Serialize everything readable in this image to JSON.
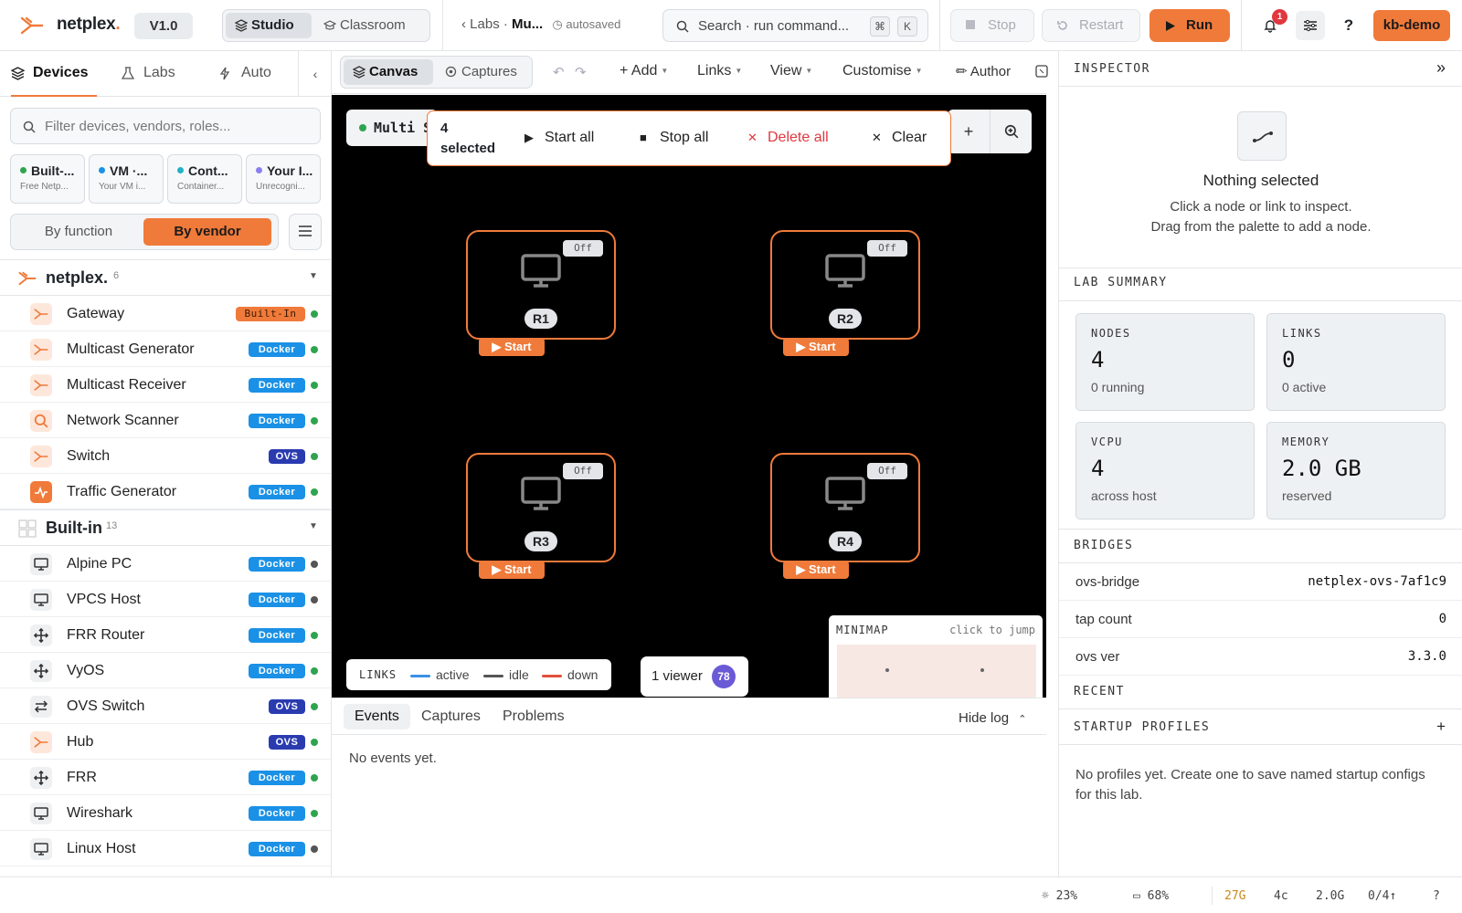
{
  "app": {
    "brand": "netplex",
    "brand_dot": ".",
    "version": "V1.0"
  },
  "modes": [
    "Studio",
    "Classroom"
  ],
  "breadcrumb": {
    "back": "Labs",
    "sep": "·",
    "current": "Mu...",
    "status": "autosaved"
  },
  "search": {
    "placeholder": "Search · run command...",
    "key1": "⌘",
    "key2": "K"
  },
  "toolbar": {
    "stop": "Stop",
    "restart": "Restart",
    "run": "Run",
    "notifications": "1",
    "help": "?",
    "user": "kb-demo"
  },
  "left_tabs": [
    "Devices",
    "Labs",
    "Auto"
  ],
  "filter_placeholder": "Filter devices, vendors, roles...",
  "palette_cards": [
    {
      "title": "Built-...",
      "sub": "Free Netp...",
      "color": "#2fa44f"
    },
    {
      "title": "VM ·...",
      "sub": "Your VM i...",
      "color": "#1a91e6"
    },
    {
      "title": "Cont...",
      "sub": "Container...",
      "color": "#20b2c8"
    },
    {
      "title": "Your I...",
      "sub": "Unrecogni...",
      "color": "#8a7ff0"
    }
  ],
  "grouping": {
    "by_function": "By function",
    "by_vendor": "By vendor"
  },
  "groups": [
    {
      "name": "netplex.",
      "count": "6",
      "items": [
        {
          "name": "Gateway",
          "tag": "Built-In",
          "kind": "bi",
          "status": "green",
          "icon": "netplex-logo-icon"
        },
        {
          "name": "Multicast Generator",
          "tag": "Docker",
          "kind": "docker",
          "status": "green",
          "icon": "netplex-logo-icon"
        },
        {
          "name": "Multicast Receiver",
          "tag": "Docker",
          "kind": "docker",
          "status": "green",
          "icon": "netplex-logo-icon"
        },
        {
          "name": "Network Scanner",
          "tag": "Docker",
          "kind": "docker",
          "status": "green",
          "icon": "magnifier-icon"
        },
        {
          "name": "Switch",
          "tag": "OVS",
          "kind": "ovs",
          "status": "green",
          "icon": "netplex-logo-icon"
        },
        {
          "name": "Traffic Generator",
          "tag": "Docker",
          "kind": "docker",
          "status": "green",
          "icon": "pulse-icon"
        }
      ]
    },
    {
      "name": "Built-in",
      "count": "13",
      "items": [
        {
          "name": "Alpine PC",
          "tag": "Docker",
          "kind": "docker",
          "status": "gray",
          "icon": "monitor-icon"
        },
        {
          "name": "VPCS Host",
          "tag": "Docker",
          "kind": "docker",
          "status": "gray",
          "icon": "monitor-icon"
        },
        {
          "name": "FRR Router",
          "tag": "Docker",
          "kind": "docker",
          "status": "green",
          "icon": "router-arrows-icon"
        },
        {
          "name": "VyOS",
          "tag": "Docker",
          "kind": "docker",
          "status": "green",
          "icon": "router-arrows-icon"
        },
        {
          "name": "OVS Switch",
          "tag": "OVS",
          "kind": "ovs",
          "status": "green",
          "icon": "switch-arrows-icon"
        },
        {
          "name": "Hub",
          "tag": "OVS",
          "kind": "ovs",
          "status": "green",
          "icon": "netplex-logo-icon"
        },
        {
          "name": "FRR",
          "tag": "Docker",
          "kind": "docker",
          "status": "green",
          "icon": "router-arrows-icon"
        },
        {
          "name": "Wireshark",
          "tag": "Docker",
          "kind": "docker",
          "status": "green",
          "icon": "monitor-icon"
        },
        {
          "name": "Linux Host",
          "tag": "Docker",
          "kind": "docker",
          "status": "gray",
          "icon": "monitor-icon"
        }
      ]
    }
  ],
  "canvas_tabs": [
    "Canvas",
    "Captures"
  ],
  "canvas_menus": [
    "+ Add",
    "Links",
    "View",
    "Customise",
    "✏ Author"
  ],
  "lab_name": "Multi S",
  "selection": {
    "count": "4 selected",
    "start_all": "Start all",
    "stop_all": "Stop all",
    "delete_all": "Delete all",
    "clear": "Clear"
  },
  "nodes": [
    {
      "label": "R1",
      "state": "Off",
      "start": "▶ Start"
    },
    {
      "label": "R2",
      "state": "Off",
      "start": "▶ Start"
    },
    {
      "label": "R3",
      "state": "Off",
      "start": "▶ Start"
    },
    {
      "label": "R4",
      "state": "Off",
      "start": "▶ Start"
    }
  ],
  "legend": {
    "title": "LINKS",
    "active": "active",
    "idle": "idle",
    "down": "down",
    "colors": {
      "active": "#3b8fe6",
      "idle": "#555555",
      "down": "#e0503a"
    }
  },
  "viewers": {
    "text": "1 viewer",
    "avatar": "78"
  },
  "minimap": {
    "title": "MINIMAP",
    "hint": "click to jump"
  },
  "log": {
    "tabs": [
      "Events",
      "Captures",
      "Problems"
    ],
    "hide": "Hide log",
    "empty": "No events yet."
  },
  "inspector": {
    "title": "INSPECTOR",
    "empty_title": "Nothing selected",
    "empty_line1": "Click a node or link to inspect.",
    "empty_line2": "Drag from the palette to add a node.",
    "summary_title": "LAB SUMMARY",
    "stats": [
      {
        "key": "NODES",
        "value": "4",
        "sub": "0 running"
      },
      {
        "key": "LINKS",
        "value": "0",
        "sub": "0 active"
      },
      {
        "key": "VCPU",
        "value": "4",
        "sub": "across host"
      },
      {
        "key": "MEMORY",
        "value": "2.0 GB",
        "sub": "reserved"
      }
    ],
    "bridges_title": "BRIDGES",
    "bridges": [
      {
        "k": "ovs-bridge",
        "v": "netplex-ovs-7af1c9"
      },
      {
        "k": "tap count",
        "v": "0"
      },
      {
        "k": "ovs ver",
        "v": "3.3.0"
      }
    ],
    "recent_title": "RECENT",
    "profiles_title": "STARTUP PROFILES",
    "profiles_add": "+",
    "profiles_empty": "No profiles yet. Create one to save named startup configs for this lab."
  },
  "statusbar": {
    "cpu": "23%",
    "mem": "68%",
    "disk": "27G",
    "cores": "4c",
    "ram": "2.0G",
    "net": "0/4↑",
    "help": "?"
  },
  "colors": {
    "accent": "#f07a3a",
    "docker": "#1a91e6",
    "ovs": "#2a3bb0",
    "ok": "#2fa44f",
    "idle": "#555555"
  }
}
